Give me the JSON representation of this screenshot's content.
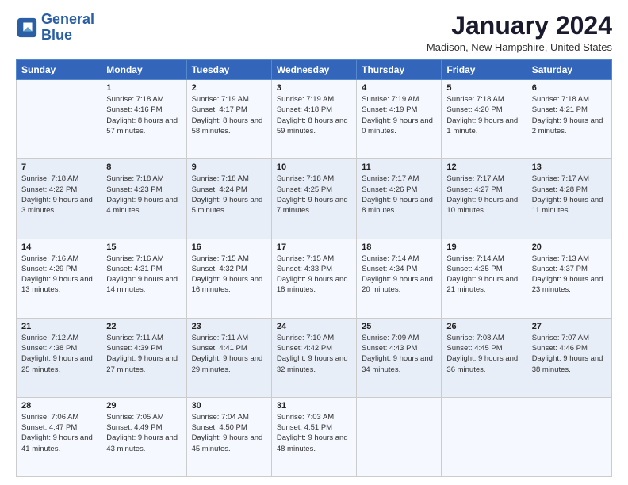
{
  "logo": {
    "line1": "General",
    "line2": "Blue"
  },
  "header": {
    "title": "January 2024",
    "location": "Madison, New Hampshire, United States"
  },
  "weekdays": [
    "Sunday",
    "Monday",
    "Tuesday",
    "Wednesday",
    "Thursday",
    "Friday",
    "Saturday"
  ],
  "weeks": [
    [
      {
        "day": "",
        "sunrise": "",
        "sunset": "",
        "daylight": ""
      },
      {
        "day": "1",
        "sunrise": "Sunrise: 7:18 AM",
        "sunset": "Sunset: 4:16 PM",
        "daylight": "Daylight: 8 hours and 57 minutes."
      },
      {
        "day": "2",
        "sunrise": "Sunrise: 7:19 AM",
        "sunset": "Sunset: 4:17 PM",
        "daylight": "Daylight: 8 hours and 58 minutes."
      },
      {
        "day": "3",
        "sunrise": "Sunrise: 7:19 AM",
        "sunset": "Sunset: 4:18 PM",
        "daylight": "Daylight: 8 hours and 59 minutes."
      },
      {
        "day": "4",
        "sunrise": "Sunrise: 7:19 AM",
        "sunset": "Sunset: 4:19 PM",
        "daylight": "Daylight: 9 hours and 0 minutes."
      },
      {
        "day": "5",
        "sunrise": "Sunrise: 7:18 AM",
        "sunset": "Sunset: 4:20 PM",
        "daylight": "Daylight: 9 hours and 1 minute."
      },
      {
        "day": "6",
        "sunrise": "Sunrise: 7:18 AM",
        "sunset": "Sunset: 4:21 PM",
        "daylight": "Daylight: 9 hours and 2 minutes."
      }
    ],
    [
      {
        "day": "7",
        "sunrise": "Sunrise: 7:18 AM",
        "sunset": "Sunset: 4:22 PM",
        "daylight": "Daylight: 9 hours and 3 minutes."
      },
      {
        "day": "8",
        "sunrise": "Sunrise: 7:18 AM",
        "sunset": "Sunset: 4:23 PM",
        "daylight": "Daylight: 9 hours and 4 minutes."
      },
      {
        "day": "9",
        "sunrise": "Sunrise: 7:18 AM",
        "sunset": "Sunset: 4:24 PM",
        "daylight": "Daylight: 9 hours and 5 minutes."
      },
      {
        "day": "10",
        "sunrise": "Sunrise: 7:18 AM",
        "sunset": "Sunset: 4:25 PM",
        "daylight": "Daylight: 9 hours and 7 minutes."
      },
      {
        "day": "11",
        "sunrise": "Sunrise: 7:17 AM",
        "sunset": "Sunset: 4:26 PM",
        "daylight": "Daylight: 9 hours and 8 minutes."
      },
      {
        "day": "12",
        "sunrise": "Sunrise: 7:17 AM",
        "sunset": "Sunset: 4:27 PM",
        "daylight": "Daylight: 9 hours and 10 minutes."
      },
      {
        "day": "13",
        "sunrise": "Sunrise: 7:17 AM",
        "sunset": "Sunset: 4:28 PM",
        "daylight": "Daylight: 9 hours and 11 minutes."
      }
    ],
    [
      {
        "day": "14",
        "sunrise": "Sunrise: 7:16 AM",
        "sunset": "Sunset: 4:29 PM",
        "daylight": "Daylight: 9 hours and 13 minutes."
      },
      {
        "day": "15",
        "sunrise": "Sunrise: 7:16 AM",
        "sunset": "Sunset: 4:31 PM",
        "daylight": "Daylight: 9 hours and 14 minutes."
      },
      {
        "day": "16",
        "sunrise": "Sunrise: 7:15 AM",
        "sunset": "Sunset: 4:32 PM",
        "daylight": "Daylight: 9 hours and 16 minutes."
      },
      {
        "day": "17",
        "sunrise": "Sunrise: 7:15 AM",
        "sunset": "Sunset: 4:33 PM",
        "daylight": "Daylight: 9 hours and 18 minutes."
      },
      {
        "day": "18",
        "sunrise": "Sunrise: 7:14 AM",
        "sunset": "Sunset: 4:34 PM",
        "daylight": "Daylight: 9 hours and 20 minutes."
      },
      {
        "day": "19",
        "sunrise": "Sunrise: 7:14 AM",
        "sunset": "Sunset: 4:35 PM",
        "daylight": "Daylight: 9 hours and 21 minutes."
      },
      {
        "day": "20",
        "sunrise": "Sunrise: 7:13 AM",
        "sunset": "Sunset: 4:37 PM",
        "daylight": "Daylight: 9 hours and 23 minutes."
      }
    ],
    [
      {
        "day": "21",
        "sunrise": "Sunrise: 7:12 AM",
        "sunset": "Sunset: 4:38 PM",
        "daylight": "Daylight: 9 hours and 25 minutes."
      },
      {
        "day": "22",
        "sunrise": "Sunrise: 7:11 AM",
        "sunset": "Sunset: 4:39 PM",
        "daylight": "Daylight: 9 hours and 27 minutes."
      },
      {
        "day": "23",
        "sunrise": "Sunrise: 7:11 AM",
        "sunset": "Sunset: 4:41 PM",
        "daylight": "Daylight: 9 hours and 29 minutes."
      },
      {
        "day": "24",
        "sunrise": "Sunrise: 7:10 AM",
        "sunset": "Sunset: 4:42 PM",
        "daylight": "Daylight: 9 hours and 32 minutes."
      },
      {
        "day": "25",
        "sunrise": "Sunrise: 7:09 AM",
        "sunset": "Sunset: 4:43 PM",
        "daylight": "Daylight: 9 hours and 34 minutes."
      },
      {
        "day": "26",
        "sunrise": "Sunrise: 7:08 AM",
        "sunset": "Sunset: 4:45 PM",
        "daylight": "Daylight: 9 hours and 36 minutes."
      },
      {
        "day": "27",
        "sunrise": "Sunrise: 7:07 AM",
        "sunset": "Sunset: 4:46 PM",
        "daylight": "Daylight: 9 hours and 38 minutes."
      }
    ],
    [
      {
        "day": "28",
        "sunrise": "Sunrise: 7:06 AM",
        "sunset": "Sunset: 4:47 PM",
        "daylight": "Daylight: 9 hours and 41 minutes."
      },
      {
        "day": "29",
        "sunrise": "Sunrise: 7:05 AM",
        "sunset": "Sunset: 4:49 PM",
        "daylight": "Daylight: 9 hours and 43 minutes."
      },
      {
        "day": "30",
        "sunrise": "Sunrise: 7:04 AM",
        "sunset": "Sunset: 4:50 PM",
        "daylight": "Daylight: 9 hours and 45 minutes."
      },
      {
        "day": "31",
        "sunrise": "Sunrise: 7:03 AM",
        "sunset": "Sunset: 4:51 PM",
        "daylight": "Daylight: 9 hours and 48 minutes."
      },
      {
        "day": "",
        "sunrise": "",
        "sunset": "",
        "daylight": ""
      },
      {
        "day": "",
        "sunrise": "",
        "sunset": "",
        "daylight": ""
      },
      {
        "day": "",
        "sunrise": "",
        "sunset": "",
        "daylight": ""
      }
    ]
  ]
}
